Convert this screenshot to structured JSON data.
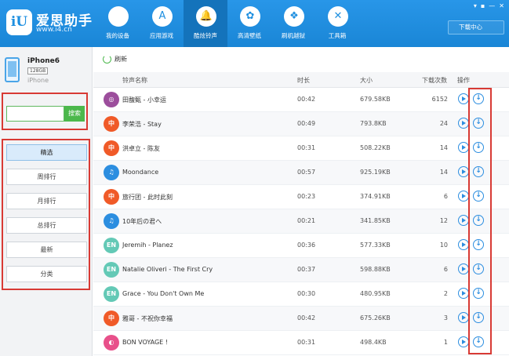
{
  "app": {
    "logo_mark": "iU",
    "name": "爱思助手",
    "url": "www.i4.cn"
  },
  "nav": [
    {
      "label": "我的设备",
      "icon": "apple-icon",
      "glyph": ""
    },
    {
      "label": "应用游戏",
      "icon": "app-store-icon",
      "glyph": "A"
    },
    {
      "label": "酷炫铃声",
      "icon": "bell-icon",
      "glyph": "🔔",
      "active": true
    },
    {
      "label": "高清壁纸",
      "icon": "flower-icon",
      "glyph": "✿"
    },
    {
      "label": "刷机越狱",
      "icon": "dropbox-icon",
      "glyph": "❖"
    },
    {
      "label": "工具箱",
      "icon": "tools-icon",
      "glyph": "✕"
    }
  ],
  "window_controls": [
    "▾",
    "▪",
    "—",
    "✕"
  ],
  "download_center": "下载中心",
  "device": {
    "name": "iPhone6",
    "storage": "128GB",
    "model": "iPhone"
  },
  "search": {
    "placeholder": "",
    "button": "搜索"
  },
  "categories": [
    "精选",
    "周排行",
    "月排行",
    "总排行",
    "最新",
    "分类"
  ],
  "toolbar": {
    "refresh": "刷新"
  },
  "columns": {
    "name": "铃声名称",
    "duration": "时长",
    "size": "大小",
    "downloads": "下载次数",
    "actions": "操作"
  },
  "ringtones": [
    {
      "badge": "◎",
      "color": "#9c4e9c",
      "name": "田馥甄 - 小幸运",
      "duration": "00:42",
      "size": "679.58KB",
      "downloads": "6152"
    },
    {
      "badge": "中",
      "color": "#f05a28",
      "name": "李荣浩 - Stay",
      "duration": "00:49",
      "size": "793.8KB",
      "downloads": "24"
    },
    {
      "badge": "中",
      "color": "#f05a28",
      "name": "洪卓立 - 陈友",
      "duration": "00:31",
      "size": "508.22KB",
      "downloads": "14"
    },
    {
      "badge": "♫",
      "color": "#2c8ee0",
      "name": "Moondance",
      "duration": "00:57",
      "size": "925.19KB",
      "downloads": "14"
    },
    {
      "badge": "中",
      "color": "#f05a28",
      "name": "旅行团 - 此时此刻",
      "duration": "00:23",
      "size": "374.91KB",
      "downloads": "6"
    },
    {
      "badge": "♫",
      "color": "#2c8ee0",
      "name": "10年后の君へ",
      "duration": "00:21",
      "size": "341.85KB",
      "downloads": "12"
    },
    {
      "badge": "EN",
      "color": "#63c9b6",
      "name": "Jeremih - Planez",
      "duration": "00:36",
      "size": "577.33KB",
      "downloads": "10"
    },
    {
      "badge": "EN",
      "color": "#63c9b6",
      "name": "Natalie Oliveri - The First Cry",
      "duration": "00:37",
      "size": "598.88KB",
      "downloads": "6"
    },
    {
      "badge": "EN",
      "color": "#63c9b6",
      "name": "Grace - You Don't Own Me",
      "duration": "00:30",
      "size": "480.95KB",
      "downloads": "2"
    },
    {
      "badge": "中",
      "color": "#f05a28",
      "name": "雅哥 - 不祝你幸福",
      "duration": "00:42",
      "size": "675.26KB",
      "downloads": "3"
    },
    {
      "badge": "◐",
      "color": "#e8508a",
      "name": "BON VOYAGE !",
      "duration": "00:31",
      "size": "498.4KB",
      "downloads": "1"
    }
  ]
}
